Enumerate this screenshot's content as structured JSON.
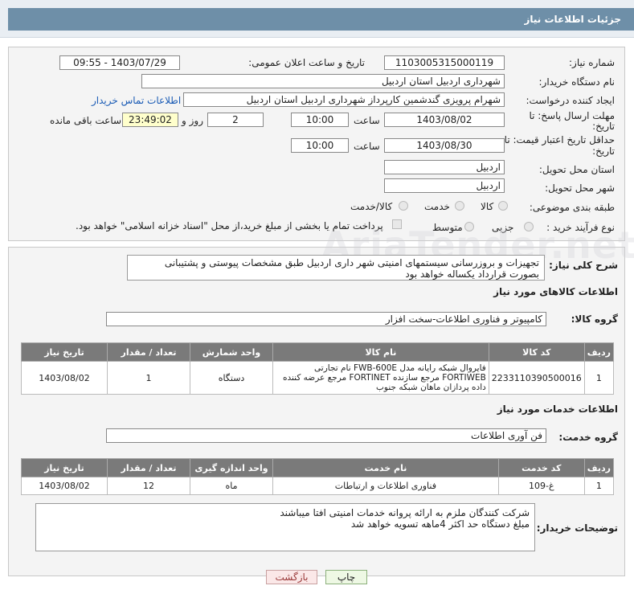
{
  "header": {
    "title": "جزئیات اطلاعات نیاز"
  },
  "info": {
    "need_number_label": "شماره نیاز:",
    "need_number": "1103005315000119",
    "announce_label": "تاریخ و ساعت اعلان عمومی:",
    "announce_value": "1403/07/29 - 09:55",
    "buyer_label": "نام دستگاه خریدار:",
    "buyer_value": "شهرداری اردبیل استان اردبیل",
    "requester_label": "ایجاد کننده درخواست:",
    "requester_value": "شهرام پرویزی گندشمین کارپرداز شهرداری اردبیل استان اردبیل",
    "contact_link": "اطلاعات تماس خریدار",
    "deadline_label": "مهلت ارسال پاسخ: تا تاریخ:",
    "deadline_date": "1403/08/02",
    "time_label": "ساعت",
    "deadline_time": "10:00",
    "days_value": "2",
    "days_label": "روز و",
    "remaining_value": "23:49:02",
    "remaining_label": "ساعت باقی مانده",
    "validity_label": "حداقل تاریخ اعتبار قیمت: تا تاریخ:",
    "validity_date": "1403/08/30",
    "validity_time": "10:00",
    "province_label": "استان محل تحویل:",
    "province_value": "اردبیل",
    "city_label": "شهر محل تحویل:",
    "city_value": "اردبیل",
    "category_label": "طبقه بندی موضوعی:",
    "category_options": [
      "کالا",
      "خدمت",
      "کالا/خدمت"
    ],
    "process_label": "نوع فرآیند خرید :",
    "process_options": [
      "جزیی",
      "متوسط"
    ],
    "payment_note": "پرداخت تمام یا بخشی از مبلغ خرید،از محل \"اسناد خزانه اسلامی\" خواهد بود."
  },
  "summary": {
    "label": "شرح کلی نیاز:",
    "text": "تجهیزات و بروزرسانی سیستمهای امنیتی شهر داری اردبیل طبق مشخصات پیوستی و پشتیبانی بصورت قرارداد یکساله خواهد بود"
  },
  "goods": {
    "section_title": "اطلاعات کالاهای مورد نیاز",
    "group_label": "گروه کالا:",
    "group_value": "کامپیوتر و فناوری اطلاعات-سخت افزار",
    "columns": [
      "ردیف",
      "کد کالا",
      "نام کالا",
      "واحد شمارش",
      "تعداد / مقدار",
      "تاریخ نیاز"
    ],
    "rows": [
      {
        "row": "1",
        "code": "2233110390500016",
        "name": "فایروال شبکه رایانه مدل FWB-600E نام تجارتی FORTIWEB مرجع سازنده FORTINET مرجع عرضه کننده داده پردازان ماهان شبکه جنوب",
        "unit": "دستگاه",
        "qty": "1",
        "date": "1403/08/02"
      }
    ]
  },
  "services": {
    "section_title": "اطلاعات خدمات مورد نیاز",
    "group_label": "گروه خدمت:",
    "group_value": "فن آوری اطلاعات",
    "columns": [
      "ردیف",
      "کد خدمت",
      "نام خدمت",
      "واحد اندازه گیری",
      "تعداد / مقدار",
      "تاریخ نیاز"
    ],
    "rows": [
      {
        "row": "1",
        "code": "غ-109",
        "name": "فناوری اطلاعات و ارتباطات",
        "unit": "ماه",
        "qty": "12",
        "date": "1403/08/02"
      }
    ]
  },
  "notes": {
    "label": "توضیحات خریدار:",
    "line1": "شرکت کنندگان ملزم به ارائه پروانه خدمات امنیتی افتا میباشند",
    "line2": "مبلغ دستگاه حد اکثر 4ماهه تسویه خواهد شد"
  },
  "buttons": {
    "print": "چاپ",
    "back": "بازگشت"
  },
  "watermark": "AriaTender.net"
}
